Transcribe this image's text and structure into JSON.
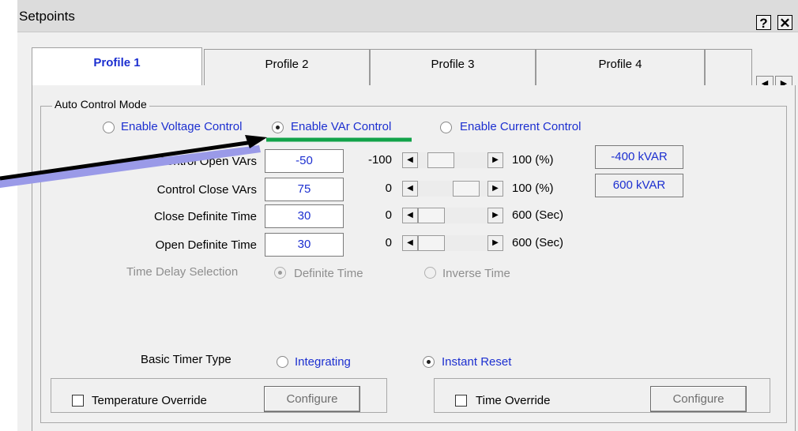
{
  "window": {
    "title": "Setpoints",
    "help_label": "?",
    "close_label": "✕"
  },
  "tabs": [
    {
      "label": "Profile 1",
      "active": true
    },
    {
      "label": "Profile 2",
      "active": false
    },
    {
      "label": "Profile 3",
      "active": false
    },
    {
      "label": "Profile 4",
      "active": false
    }
  ],
  "tab_scroll": {
    "left_icon": "◀",
    "right_icon": "▶"
  },
  "auto_control": {
    "group_label": "Auto Control Mode",
    "modes": [
      {
        "label": "Enable Voltage Control",
        "selected": false
      },
      {
        "label": "Enable VAr Control",
        "selected": true
      },
      {
        "label": "Enable Current Control",
        "selected": false
      }
    ],
    "rows": [
      {
        "label": "Control Open VArs",
        "value": "-50",
        "min": "-100",
        "max": "100 (%)",
        "readout": "-400 kVAR",
        "slider_fraction": 0.25
      },
      {
        "label": "Control Close VArs",
        "value": "75",
        "min": "0",
        "max": "100 (%)",
        "readout": "600 kVAR",
        "slider_fraction": 0.75
      },
      {
        "label": "Close Definite Time",
        "value": "30",
        "min": "0",
        "max": "600 (Sec)",
        "slider_fraction": 0.05
      },
      {
        "label": "Open Definite Time",
        "value": "30",
        "min": "0",
        "max": "600 (Sec)",
        "slider_fraction": 0.05
      }
    ],
    "time_delay": {
      "label": "Time Delay Selection",
      "options": [
        {
          "label": "Definite Time",
          "selected": true
        },
        {
          "label": "Inverse Time",
          "selected": false
        }
      ]
    },
    "basic_timer": {
      "label": "Basic Timer Type",
      "options": [
        {
          "label": "Integrating",
          "selected": false
        },
        {
          "label": "Instant Reset",
          "selected": true
        }
      ]
    },
    "temperature_override": {
      "label": "Temperature Override",
      "checked": false,
      "button": "Configure"
    },
    "time_override": {
      "label": "Time Override",
      "checked": false,
      "button": "Configure"
    }
  },
  "annotation": {
    "arrow_color": "#000000",
    "shadow_color": "#9a9ae8",
    "underline_color": "#12a34a"
  }
}
